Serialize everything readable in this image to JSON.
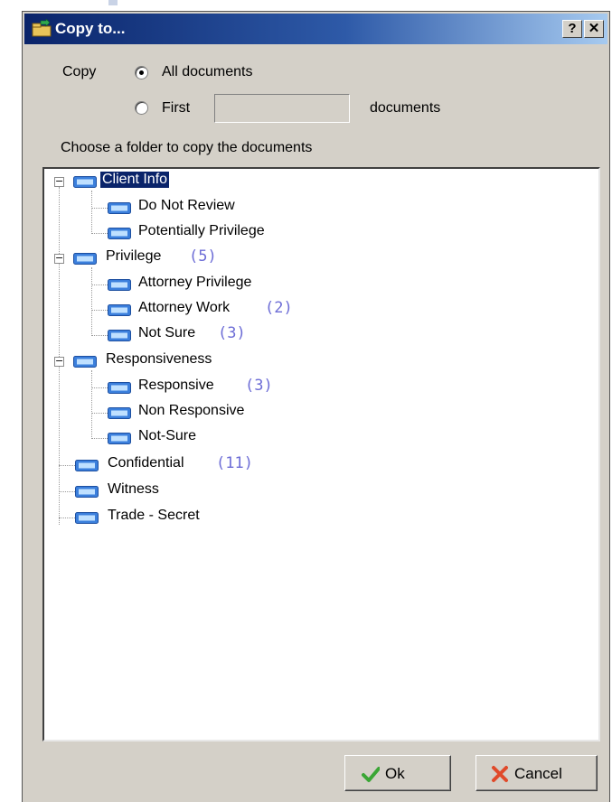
{
  "dialog": {
    "title": "Copy to...",
    "help_button": "?",
    "close_button": "✕"
  },
  "copy_options": {
    "label": "Copy",
    "all_documents": "All documents",
    "all_selected": true,
    "first": "First",
    "first_count_value": "",
    "documents_suffix": "documents"
  },
  "folder_prompt": "Choose a folder to copy the documents",
  "tree": {
    "nodes": [
      {
        "label": "Client Info",
        "count": "",
        "selected": true,
        "expanded": true
      },
      {
        "label": "Do Not Review",
        "count": ""
      },
      {
        "label": "Potentially Privilege",
        "count": ""
      },
      {
        "label": "Privilege",
        "count": "(5)",
        "expanded": true
      },
      {
        "label": "Attorney Privilege",
        "count": ""
      },
      {
        "label": "Attorney Work",
        "count": "(2)"
      },
      {
        "label": "Not Sure",
        "count": "(3)"
      },
      {
        "label": "Responsiveness",
        "count": "",
        "expanded": true
      },
      {
        "label": "Responsive",
        "count": "(3)"
      },
      {
        "label": "Non Responsive",
        "count": ""
      },
      {
        "label": "Not-Sure",
        "count": ""
      },
      {
        "label": "Confidential",
        "count": "(11)"
      },
      {
        "label": "Witness",
        "count": ""
      },
      {
        "label": "Trade - Secret",
        "count": ""
      }
    ]
  },
  "buttons": {
    "ok": "Ok",
    "cancel": "Cancel"
  },
  "colors": {
    "titlebar_start": "#0a246a",
    "titlebar_end": "#a6caf0",
    "selection": "#0a246a",
    "count_text": "#6d6dd6",
    "dialog_face": "#d4d0c8"
  }
}
